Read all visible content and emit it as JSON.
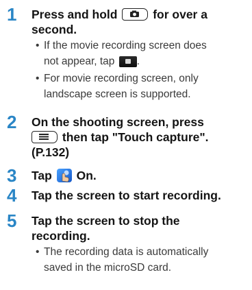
{
  "steps": [
    {
      "number": "1",
      "line1_a": "Press and hold",
      "line1_b": "for over a",
      "line2": "second."
    },
    {
      "number": "2",
      "line1": "On the shooting screen, press",
      "line2_b": "then tap \"Touch capture\".",
      "line3": "(P.132)"
    },
    {
      "number": "3",
      "text_a": "Tap",
      "text_b": "On."
    },
    {
      "number": "4",
      "text": "Tap the screen to start recording."
    },
    {
      "number": "5",
      "line1": "Tap the screen to stop the",
      "line2": "recording."
    }
  ],
  "bullets": {
    "b1_line1": "If the movie recording screen does",
    "b1_line2": "not appear, tap",
    "b2_line1": "For movie recording screen, only",
    "b2_line2": "landscape screen is supported.",
    "b3_line1": "The recording data is automatically",
    "b3_line2": "saved in the microSD card.",
    "marker": "•"
  },
  "icons": {
    "camera_key": "camera-key-icon",
    "movie_button": "movie-record-icon",
    "menu_key": "menu-key-icon",
    "touch_capture": "touch-capture-icon"
  },
  "colors": {
    "step_number": "#2a86c6",
    "heading_text": "#141414",
    "bullet_text": "#3a3a3a"
  }
}
